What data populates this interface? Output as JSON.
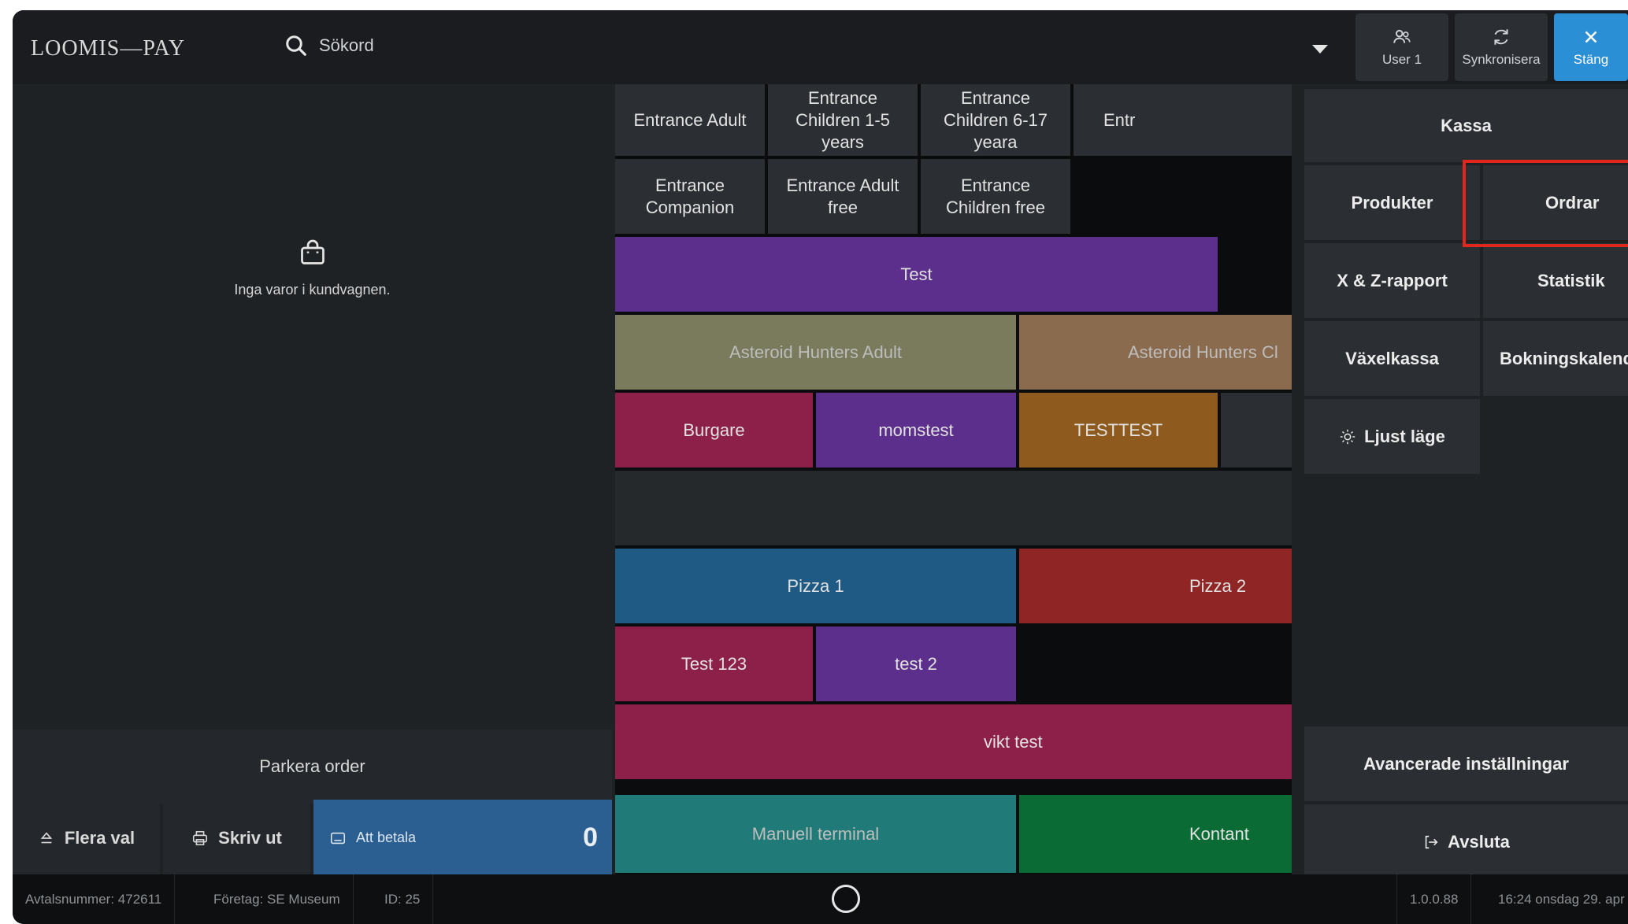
{
  "header": {
    "logo": "LOOMIS—PAY",
    "search_placeholder": "Sökord",
    "user_label": "User 1",
    "sync_label": "Synkronisera",
    "close_label": "Stäng"
  },
  "cart": {
    "empty_text": "Inga varor i kundvagnen.",
    "park_order": "Parkera order",
    "more_options": "Flera val",
    "print": "Skriv ut",
    "to_pay_label": "Att betala",
    "to_pay_amount": "0"
  },
  "products": {
    "entrance_adult": "Entrance Adult",
    "entrance_children_1_5": "Entrance Children 1-5 years",
    "entrance_children_6_17": "Entrance Children 6-17 yeara",
    "entrance_partial": "Entr",
    "entrance_companion": "Entrance Companion",
    "entrance_adult_free": "Entrance Adult free",
    "entrance_children_free": "Entrance Children free",
    "test": "Test",
    "asteroid_adult": "Asteroid Hunters Adult",
    "asteroid_children_partial": "Asteroid Hunters Cl",
    "burgare": "Burgare",
    "momstest": "momstest",
    "testtest": "TESTTEST",
    "pizza1": "Pizza 1",
    "pizza2": "Pizza 2",
    "test123": "Test 123",
    "test2": "test 2",
    "vikt_test": "vikt test",
    "manuell_terminal": "Manuell terminal",
    "kontant": "Kontant"
  },
  "menu": {
    "kassa": "Kassa",
    "produkter": "Produkter",
    "ordrar": "Ordrar",
    "xz_rapport": "X & Z-rapport",
    "statistik": "Statistik",
    "vaxelkassa": "Växelkassa",
    "bokningskalender": "Bokningskalender",
    "ljust_lage": "Ljust läge",
    "avancerade": "Avancerade inställningar",
    "avsluta": "Avsluta"
  },
  "status": {
    "avtalsnummer": "Avtalsnummer: 472611",
    "foretag": "Företag: SE Museum",
    "id": "ID: 25",
    "version": "1.0.0.88",
    "datetime": "16:24 onsdag 29. apr"
  },
  "colors": {
    "accent_blue": "#2b8fd6",
    "highlight_red": "#e1261c",
    "purple": "#5b2f8b",
    "olive": "#7a7a5c",
    "brown": "#8a6b4e",
    "crimson": "#8d2048",
    "orange": "#8e5a1e",
    "steel_blue": "#1f5a85",
    "red": "#8f2525",
    "teal": "#1f7a78",
    "green": "#0a6b35"
  }
}
